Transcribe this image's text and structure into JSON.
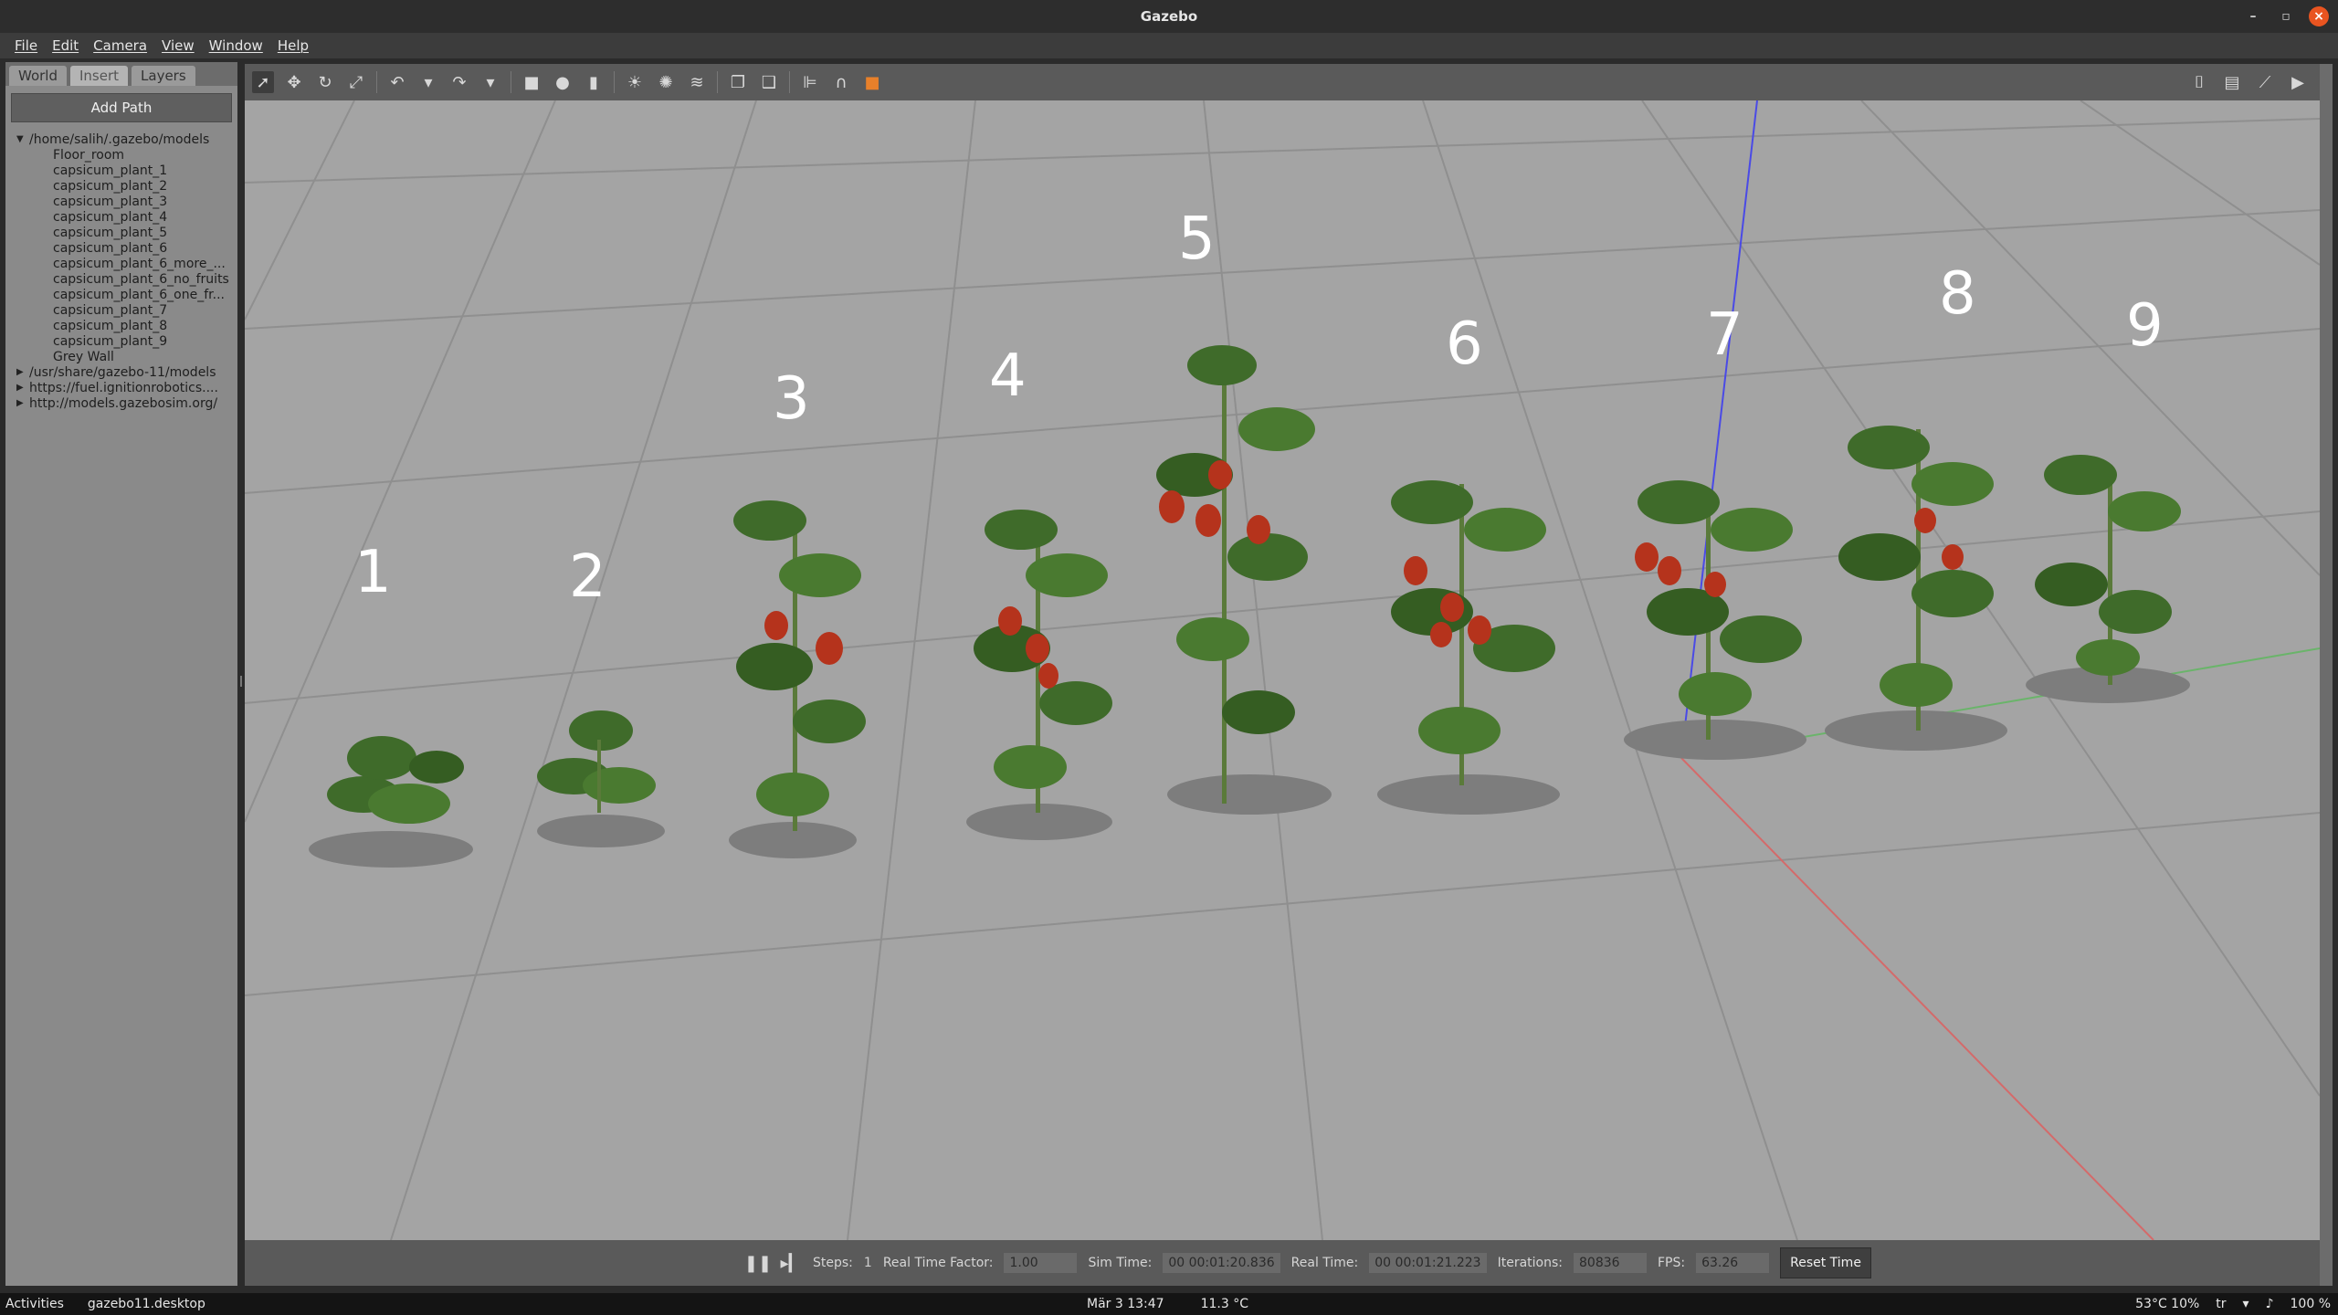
{
  "window": {
    "title": "Gazebo",
    "minimize": "–",
    "maximize": "▫",
    "close": "×"
  },
  "menu": [
    "File",
    "Edit",
    "Camera",
    "View",
    "Window",
    "Help"
  ],
  "left_panel": {
    "tabs": [
      "World",
      "Insert",
      "Layers"
    ],
    "add_path_label": "Add Path",
    "tree_root": "/home/salih/.gazebo/models",
    "tree_children": [
      "Floor_room",
      "capsicum_plant_1",
      "capsicum_plant_2",
      "capsicum_plant_3",
      "capsicum_plant_4",
      "capsicum_plant_5",
      "capsicum_plant_6",
      "capsicum_plant_6_more_...",
      "capsicum_plant_6_no_fruits",
      "capsicum_plant_6_one_fr...",
      "capsicum_plant_7",
      "capsicum_plant_8",
      "capsicum_plant_9",
      "Grey Wall"
    ],
    "tree_other_roots": [
      "/usr/share/gazebo-11/models",
      "https://fuel.ignitionrobotics....",
      "http://models.gazebosim.org/"
    ]
  },
  "viewport": {
    "plant_labels": [
      "1",
      "2",
      "3",
      "4",
      "5",
      "6",
      "7",
      "8",
      "9"
    ]
  },
  "status": {
    "steps_label": "Steps:",
    "steps_value": "1",
    "rtf_label": "Real Time Factor:",
    "rtf_value": "1.00",
    "sim_time_label": "Sim Time:",
    "sim_time_value": "00 00:01:20.836",
    "real_time_label": "Real Time:",
    "real_time_value": "00 00:01:21.223",
    "iterations_label": "Iterations:",
    "iterations_value": "80836",
    "fps_label": "FPS:",
    "fps_value": "63.26",
    "reset_label": "Reset Time"
  },
  "taskbar": {
    "activities": "Activities",
    "app": "gazebo11.desktop",
    "datetime": "Mär 3  13:47",
    "weather": "11.3 °C",
    "cpu": "53°C 10%",
    "input": "tr",
    "battery": "100 %"
  },
  "colors": {
    "viewport_bg": "#a4a4a4",
    "grid": "#8f8f8f",
    "axis_x": "#d46a6a",
    "axis_y": "#6ab46a",
    "axis_z": "#4a4ae6",
    "leaf": "#3f6b2a",
    "pepper": "#b5331c"
  }
}
